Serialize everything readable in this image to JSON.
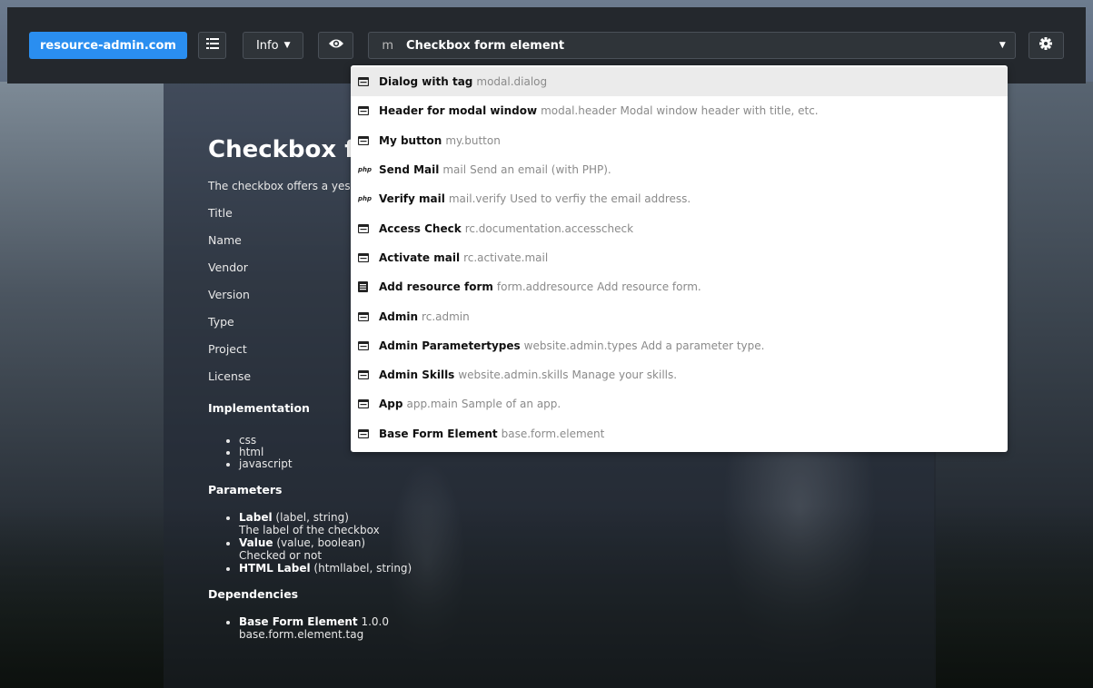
{
  "header": {
    "brand": "resource-admin.com",
    "info_label": "Info",
    "search_prefix": "m",
    "search_value": "Checkbox form element"
  },
  "page": {
    "title": "Checkbox fo",
    "description": "The checkbox offers a yes /",
    "meta": [
      "Title",
      "Name",
      "Vendor",
      "Version",
      "Type",
      "Project",
      "License"
    ],
    "implementation_heading": "Implementation",
    "implementation": [
      "css",
      "html",
      "javascript"
    ],
    "parameters_heading": "Parameters",
    "parameters": [
      {
        "name": "Label",
        "sig": "(label, string)",
        "desc": "The label of the checkbox"
      },
      {
        "name": "Value",
        "sig": "(value, boolean)",
        "desc": "Checked or not"
      },
      {
        "name": "HTML Label",
        "sig": "(htmllabel, string)",
        "desc": ""
      }
    ],
    "dependencies_heading": "Dependencies",
    "dependencies": [
      {
        "name": "Base Form Element",
        "version": "1.0.0",
        "tag": "base.form.element.tag"
      }
    ]
  },
  "dropdown": {
    "items": [
      {
        "icon": "window-icon",
        "title": "Dialog with tag",
        "key": "modal.dialog",
        "desc": ""
      },
      {
        "icon": "window-icon",
        "title": "Header for modal window",
        "key": "modal.header",
        "desc": "Modal window header with title, etc."
      },
      {
        "icon": "window-icon",
        "title": "My button",
        "key": "my.button",
        "desc": ""
      },
      {
        "icon": "php-icon",
        "title": "Send Mail",
        "key": "mail",
        "desc": "Send an email (with PHP)."
      },
      {
        "icon": "php-icon",
        "title": "Verify mail",
        "key": "mail.verify",
        "desc": "Used to verfiy the email address."
      },
      {
        "icon": "window-icon",
        "title": "Access Check",
        "key": "rc.documentation.accesscheck",
        "desc": ""
      },
      {
        "icon": "window-icon",
        "title": "Activate mail",
        "key": "rc.activate.mail",
        "desc": ""
      },
      {
        "icon": "form-icon",
        "title": "Add resource form",
        "key": "form.addresource",
        "desc": "Add resource form."
      },
      {
        "icon": "window-icon",
        "title": "Admin",
        "key": "rc.admin",
        "desc": ""
      },
      {
        "icon": "window-icon",
        "title": "Admin Parametertypes",
        "key": "website.admin.types",
        "desc": "Add a parameter type."
      },
      {
        "icon": "window-icon",
        "title": "Admin Skills",
        "key": "website.admin.skills",
        "desc": "Manage your skills."
      },
      {
        "icon": "window-icon",
        "title": "App",
        "key": "app.main",
        "desc": "Sample of an app."
      },
      {
        "icon": "window-icon",
        "title": "Base Form Element",
        "key": "base.form.element",
        "desc": ""
      }
    ]
  },
  "colors": {
    "brand": "#2a8ef0",
    "topbar": "#24282d",
    "dropdown_active": "#ebebeb"
  }
}
